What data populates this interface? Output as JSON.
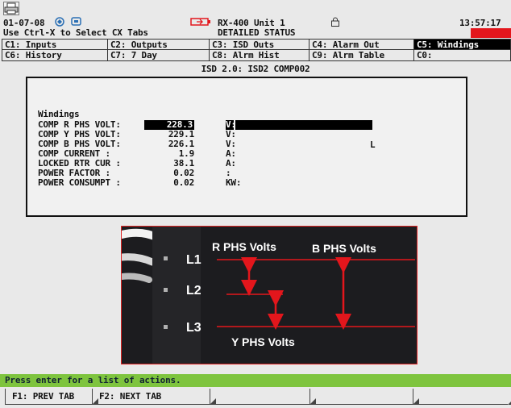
{
  "header": {
    "date": "01-07-08",
    "hint": "Use Ctrl-X to Select CX Tabs",
    "unit": "RX-400 Unit 1",
    "status": "DETAILED STATUS",
    "time": "13:57:17",
    "icons": [
      "printer-icon",
      "compressor-icon",
      "network-icon",
      "battery-icon",
      "lock-icon"
    ],
    "alarm_color": "#e3161c"
  },
  "tabs": [
    {
      "label": "C1: Inputs"
    },
    {
      "label": "C2: Outputs"
    },
    {
      "label": "C3: ISD Outs"
    },
    {
      "label": "C4: Alarm Out"
    },
    {
      "label": "C5: Windings"
    },
    {
      "label": "C6: History"
    },
    {
      "label": "C7: 7 Day"
    },
    {
      "label": "C8: Alrm Hist"
    },
    {
      "label": "C9: Alrm Table"
    },
    {
      "label": "C0:"
    }
  ],
  "active_tab": "C5: Windings",
  "isd_title": "ISD 2.0: ISD2 COMP002",
  "windings": {
    "heading": "Windings",
    "rows": [
      {
        "label": "COMP R PHS VOLT:",
        "value": "228.3",
        "unit": "V:"
      },
      {
        "label": "COMP Y PHS VOLT:",
        "value": "229.1",
        "unit": "V:"
      },
      {
        "label": "COMP B PHS VOLT:",
        "value": "226.1",
        "unit": "V:"
      },
      {
        "label": "COMP CURRENT   :",
        "value": "1.9",
        "unit": "A:"
      },
      {
        "label": "LOCKED RTR CUR :",
        "value": "38.1",
        "unit": "A:"
      },
      {
        "label": "POWER FACTOR   :",
        "value": "0.02",
        "unit": ":"
      },
      {
        "label": "POWER CONSUMPT :",
        "value": "0.02",
        "unit": "KW:"
      }
    ],
    "stray_char": "L"
  },
  "diagram": {
    "lines": [
      "L1",
      "L2",
      "L3"
    ],
    "r_label": "R PHS Volts",
    "b_label": "B PHS Volts",
    "y_label": "Y PHS Volts",
    "arrow_color": "#e3161c"
  },
  "prompt": "Press enter for a list of actions.",
  "fkeys": [
    {
      "label": "F1: PREV TAB"
    },
    {
      "label": "F2: NEXT TAB"
    },
    {
      "label": ""
    },
    {
      "label": ""
    },
    {
      "label": ""
    }
  ]
}
